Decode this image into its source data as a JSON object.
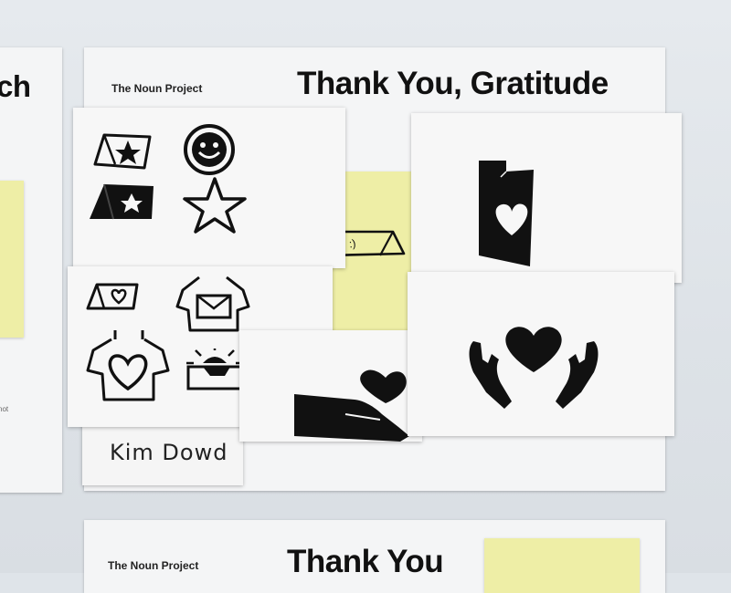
{
  "left_poster": {
    "title_fragment": "ch",
    "footnote_fragment": "not"
  },
  "main_poster": {
    "brand": "The Noun Project",
    "title": "Thank You, Gratitude",
    "signature": "Kim  Dowd"
  },
  "sticky_note": {
    "face_text": ":)"
  },
  "bottom_poster": {
    "brand": "The Noun Project",
    "title_fragment": "Thank You"
  },
  "icons": {
    "sketch_sheet_1": [
      "star-card-outline-icon",
      "smiley-face-icon",
      "star-card-filled-icon",
      "star-outline-icon"
    ],
    "sketch_sheet_2": [
      "heart-card-icon",
      "envelope-shirt-icon",
      "heart-shirt-icon",
      "sun-box-icon"
    ],
    "final_cards": [
      "heart-folded-card-icon",
      "hand-holding-heart-icon",
      "hands-around-heart-icon"
    ]
  }
}
